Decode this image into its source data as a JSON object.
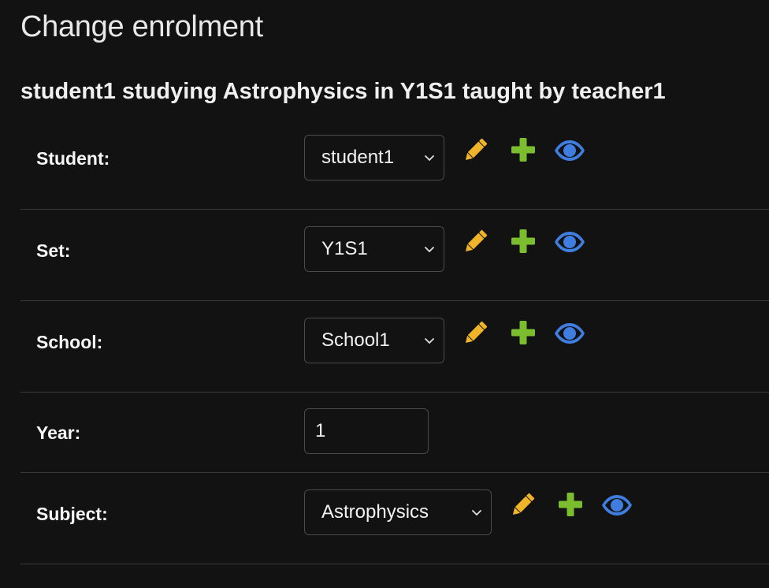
{
  "page": {
    "title": "Change enrolment",
    "object_heading": "student1 studying Astrophysics in Y1S1 taught by teacher1"
  },
  "fields": {
    "student": {
      "label": "Student:",
      "value": "student1"
    },
    "set": {
      "label": "Set:",
      "value": "Y1S1"
    },
    "school": {
      "label": "School:",
      "value": "School1"
    },
    "year": {
      "label": "Year:",
      "value": "1"
    },
    "subject": {
      "label": "Subject:",
      "value": "Astrophysics"
    }
  },
  "related_widget_icons": {
    "change": "pencil-icon",
    "add": "plus-icon",
    "view": "eye-icon"
  },
  "colors": {
    "background": "#121212",
    "pencil": "#f0b429",
    "plus": "#7cbd2f",
    "eye": "#3f7ee0",
    "border": "#4a4a4a"
  }
}
